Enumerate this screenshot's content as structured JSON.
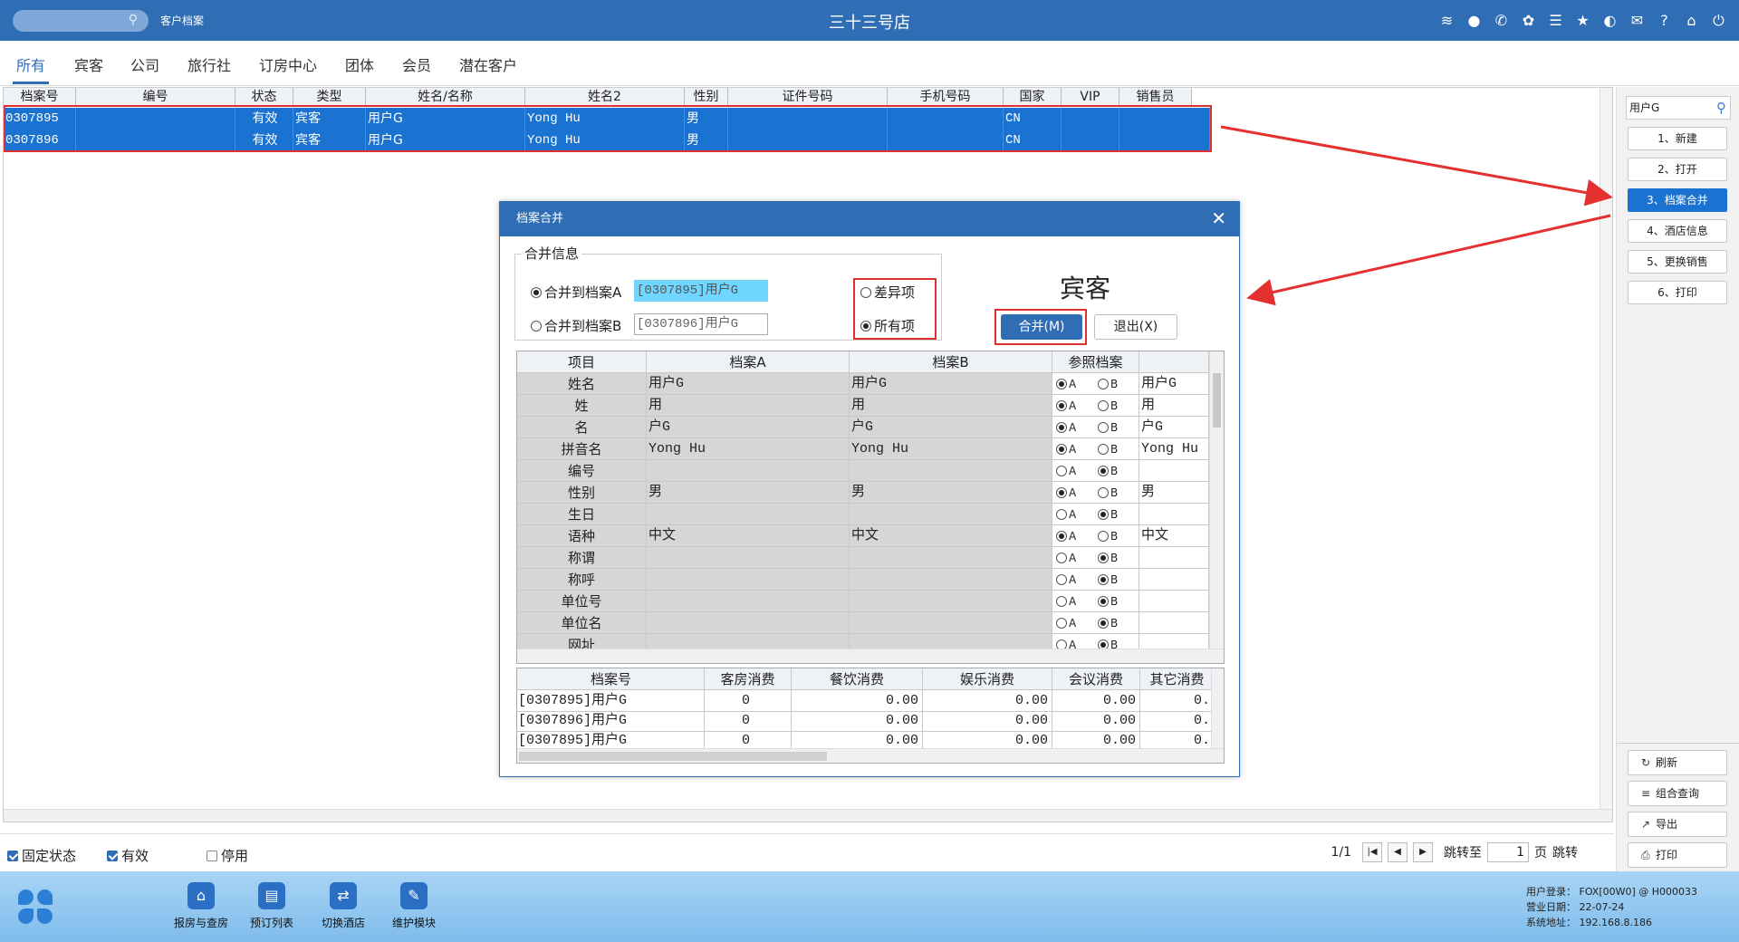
{
  "titlebar": {
    "module_label": "客户档案",
    "app_title": "三十三号店",
    "icons": [
      "wifi-icon",
      "chat-icon",
      "phone-icon",
      "palette-icon",
      "menu-icon",
      "star-icon",
      "theme-icon",
      "mail-icon",
      "help-icon",
      "home-icon",
      "power-icon"
    ]
  },
  "tabs": [
    "所有",
    "宾客",
    "公司",
    "旅行社",
    "订房中心",
    "团体",
    "会员",
    "潜在客户"
  ],
  "grid": {
    "columns": [
      "档案号",
      "编号",
      "状态",
      "类型",
      "姓名/名称",
      "姓名2",
      "性别",
      "证件号码",
      "手机号码",
      "国家",
      "VIP",
      "销售员"
    ],
    "rows": [
      [
        "0307895",
        "",
        "有效",
        "宾客",
        "用户G",
        "Yong Hu",
        "男",
        "",
        "",
        "CN",
        "",
        ""
      ],
      [
        "0307896",
        "",
        "有效",
        "宾客",
        "用户G",
        "Yong Hu",
        "男",
        "",
        "",
        "CN",
        "",
        ""
      ]
    ]
  },
  "statusbar": {
    "fixed_label": "固定状态",
    "valid_label": "有效",
    "disabled_label": "停用",
    "page_info": "1/1",
    "jump_label": "跳转至",
    "page_value": "1",
    "page_unit": "页",
    "jump_button": "跳转"
  },
  "rightpanel": {
    "search_value": "用户G",
    "buttons": [
      "1、新建",
      "2、打开",
      "3、档案合并",
      "4、酒店信息",
      "5、更换销售",
      "6、打印"
    ],
    "selected": "3、档案合并",
    "bottom_buttons": [
      {
        "label": "刷新",
        "icon": "refresh-icon"
      },
      {
        "label": "组合查询",
        "icon": "list-icon"
      },
      {
        "label": "导出",
        "icon": "export-icon"
      },
      {
        "label": "打印",
        "icon": "print-icon"
      }
    ]
  },
  "dock": {
    "items": [
      {
        "label": "报房与查房",
        "icon": "house-search-icon"
      },
      {
        "label": "预订列表",
        "icon": "reservation-list-icon"
      },
      {
        "label": "切换酒店",
        "icon": "switch-icon"
      },
      {
        "label": "维护模块",
        "icon": "wrench-icon"
      }
    ],
    "user_login": "用户登录：  FOX[00W0] @ H000033",
    "business_date": "营业日期：  22-07-24",
    "system_address": "系统地址：  192.168.8.186"
  },
  "dialog": {
    "title": "档案合并",
    "merge_info_label": "合并信息",
    "merge_to_a_label": "合并到档案A",
    "merge_to_a_value": "[0307895]用户G",
    "merge_to_b_label": "合并到档案B",
    "merge_to_b_value": "[0307896]用户G",
    "diff_label": "差异项",
    "all_label": "所有项",
    "guest_type": "宾客",
    "merge_button": "合并(M)",
    "exit_button": "退出(X)",
    "compare": {
      "headers": [
        "项目",
        "档案A",
        "档案B",
        "参照档案",
        ""
      ],
      "rows": [
        {
          "item": "姓名",
          "a": "用户G",
          "b": "用户G",
          "sel": "A",
          "ref": "用户G"
        },
        {
          "item": "姓",
          "a": "用",
          "b": "用",
          "sel": "A",
          "ref": "用"
        },
        {
          "item": "名",
          "a": "户G",
          "b": "户G",
          "sel": "A",
          "ref": "户G"
        },
        {
          "item": "拼音名",
          "a": "Yong Hu",
          "b": "Yong Hu",
          "sel": "A",
          "ref": "Yong Hu"
        },
        {
          "item": "编号",
          "a": "",
          "b": "",
          "sel": "B",
          "ref": ""
        },
        {
          "item": "性别",
          "a": "男",
          "b": "男",
          "sel": "A",
          "ref": "男"
        },
        {
          "item": "生日",
          "a": "",
          "b": "",
          "sel": "B",
          "ref": ""
        },
        {
          "item": "语种",
          "a": "中文",
          "b": "中文",
          "sel": "A",
          "ref": "中文"
        },
        {
          "item": "称谓",
          "a": "",
          "b": "",
          "sel": "B",
          "ref": ""
        },
        {
          "item": "称呼",
          "a": "",
          "b": "",
          "sel": "B",
          "ref": ""
        },
        {
          "item": "单位号",
          "a": "",
          "b": "",
          "sel": "B",
          "ref": ""
        },
        {
          "item": "单位名",
          "a": "",
          "b": "",
          "sel": "B",
          "ref": ""
        },
        {
          "item": "网址",
          "a": "",
          "b": "",
          "sel": "B",
          "ref": ""
        }
      ]
    },
    "consumption": {
      "headers": [
        "档案号",
        "客房消费",
        "餐饮消费",
        "娱乐消费",
        "会议消费",
        "其它消费"
      ],
      "rows": [
        [
          "[0307895]用户G",
          "0",
          "0.00",
          "0.00",
          "0.00",
          "0."
        ],
        [
          "[0307896]用户G",
          "0",
          "0.00",
          "0.00",
          "0.00",
          "0."
        ],
        [
          "[0307895]用户G",
          "0",
          "0.00",
          "0.00",
          "0.00",
          "0."
        ]
      ]
    }
  }
}
